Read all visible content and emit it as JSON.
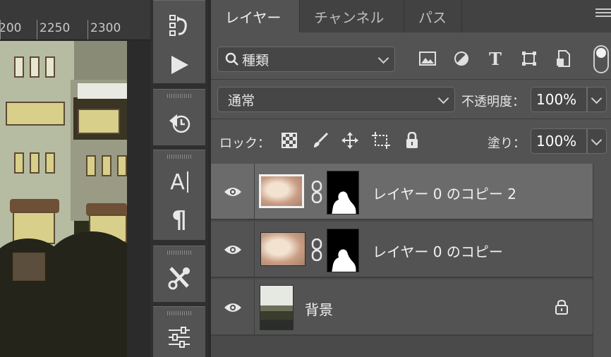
{
  "ruler": {
    "labels": [
      "200",
      "2250",
      "2300"
    ]
  },
  "tabs": [
    {
      "label": "レイヤー",
      "active": true
    },
    {
      "label": "チャンネル",
      "active": false
    },
    {
      "label": "パス",
      "active": false
    }
  ],
  "filter": {
    "kind_label": "種類",
    "icons": [
      "image-filter-icon",
      "adjustment-filter-icon",
      "type-filter-icon",
      "shape-filter-icon",
      "smart-object-filter-icon"
    ]
  },
  "blend": {
    "mode": "通常",
    "opacity_label": "不透明度：",
    "opacity_value": "100%"
  },
  "lock": {
    "label": "ロック：",
    "fill_label": "塗り：",
    "fill_value": "100%"
  },
  "layers": [
    {
      "name": "レイヤー 0 のコピー 2",
      "selected": true,
      "has_mask": true
    },
    {
      "name": "レイヤー 0 のコピー",
      "selected": false,
      "has_mask": true
    },
    {
      "name": "背景",
      "selected": false,
      "locked": true
    }
  ],
  "tool_icons": [
    "history-brush-icon",
    "play-icon",
    "rotate-view-icon",
    "character-icon",
    "paragraph-icon",
    "tools-icon",
    "adjustments-icon"
  ],
  "colors": {
    "panel_bg": "#535353",
    "selected_row": "#6b6b6b",
    "tab_bar": "#424242"
  }
}
